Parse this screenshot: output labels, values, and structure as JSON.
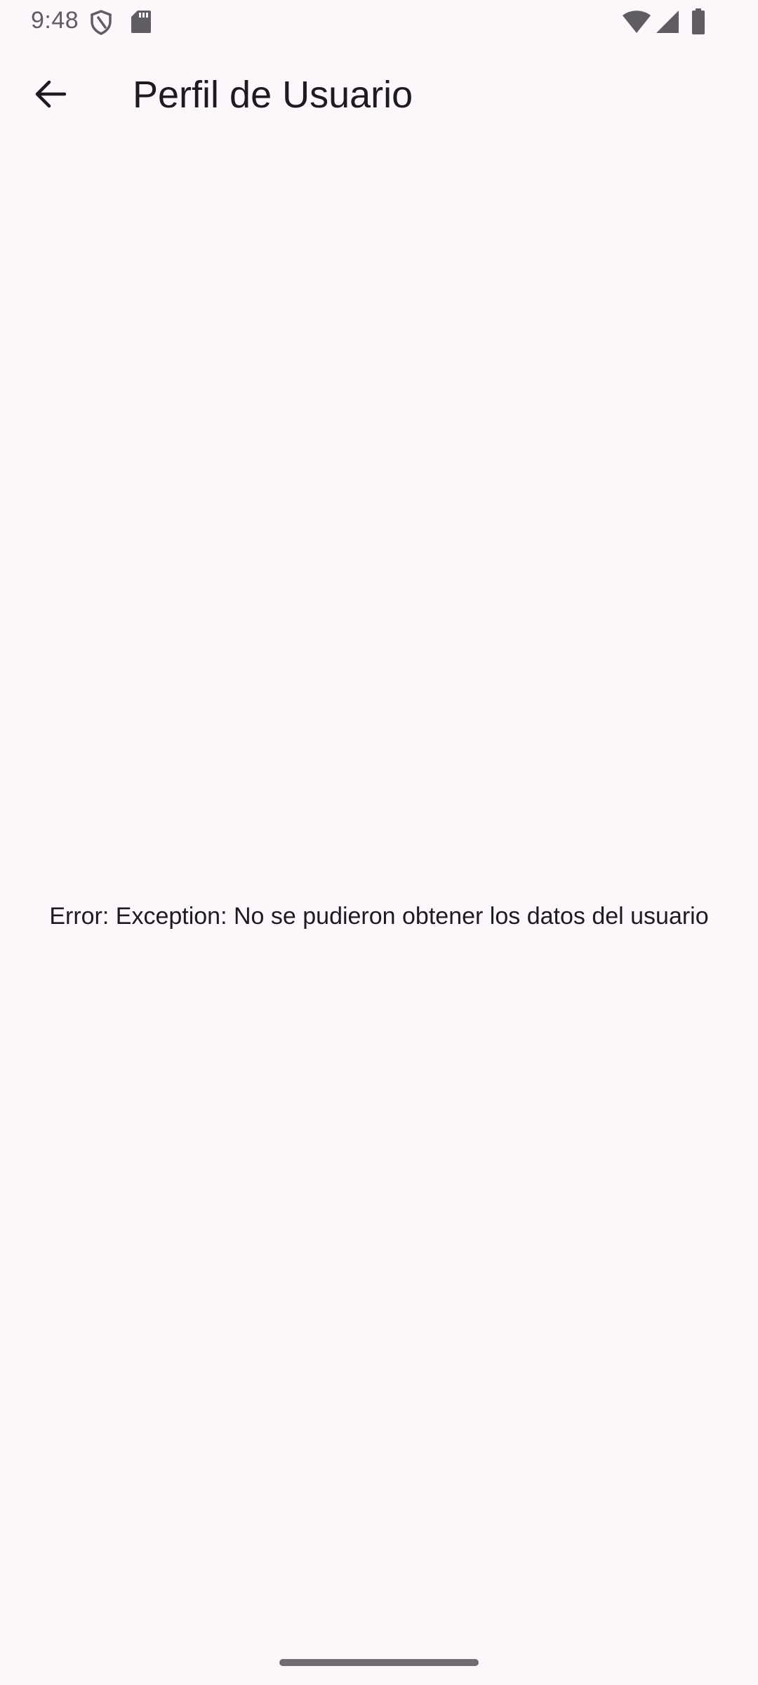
{
  "status_bar": {
    "time": "9:48",
    "icons": [
      "shield-icon",
      "sd-card-icon",
      "wifi-icon",
      "cell-signal-icon",
      "battery-icon"
    ]
  },
  "app_bar": {
    "back_icon": "arrow-back-icon",
    "title": "Perfil de Usuario"
  },
  "body": {
    "error_text": "Error: Exception: No se pudieron obtener los datos del usuario"
  },
  "colors": {
    "background": "#fdf7fc",
    "text_primary": "#1d1b20",
    "status_icons": "#5f5c63"
  }
}
